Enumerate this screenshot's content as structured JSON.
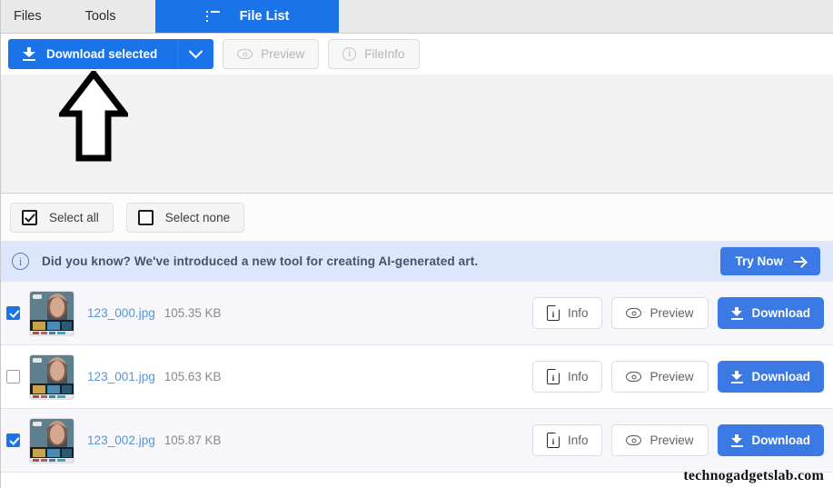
{
  "menubar": {
    "items": [
      {
        "label": "Files"
      },
      {
        "label": "Tools"
      }
    ],
    "tab": {
      "label": "File List",
      "icon": "list-icon"
    }
  },
  "toolbar": {
    "download_selected_label": "Download selected",
    "download_icon": "download-icon",
    "dropdown_icon": "chevron-down-icon",
    "preview_label": "Preview",
    "preview_icon": "eye-icon",
    "fileinfo_label": "FileInfo",
    "fileinfo_icon": "info-circle-icon"
  },
  "annotation": {
    "shape": "up-arrow",
    "color": "#000000"
  },
  "selectbar": {
    "select_all_label": "Select all",
    "select_all_icon": "checkbox-checked-icon",
    "select_none_label": "Select none",
    "select_none_icon": "checkbox-empty-icon"
  },
  "banner": {
    "icon": "info-circle-icon",
    "text": "Did you know? We've introduced a new tool for creating AI-generated art.",
    "cta_label": "Try Now",
    "cta_icon": "arrow-right-icon",
    "background": "#dce7fb",
    "cta_color": "#3b7ae4"
  },
  "file_rows": {
    "actions": {
      "info_label": "Info",
      "info_icon": "document-info-icon",
      "preview_label": "Preview",
      "preview_icon": "eye-icon",
      "download_label": "Download",
      "download_icon": "download-icon"
    },
    "items": [
      {
        "name": "123_000.jpg",
        "size": "105.35 KB",
        "selected": true
      },
      {
        "name": "123_001.jpg",
        "size": "105.63 KB",
        "selected": false
      },
      {
        "name": "123_002.jpg",
        "size": "105.87 KB",
        "selected": true
      }
    ]
  },
  "watermark": {
    "text": "technogadgetslab.com"
  },
  "colors": {
    "accent": "#1a73e8",
    "button_blue": "#3b7ae4",
    "link": "#5a96d2",
    "row_selected": "#f6f6fb"
  }
}
